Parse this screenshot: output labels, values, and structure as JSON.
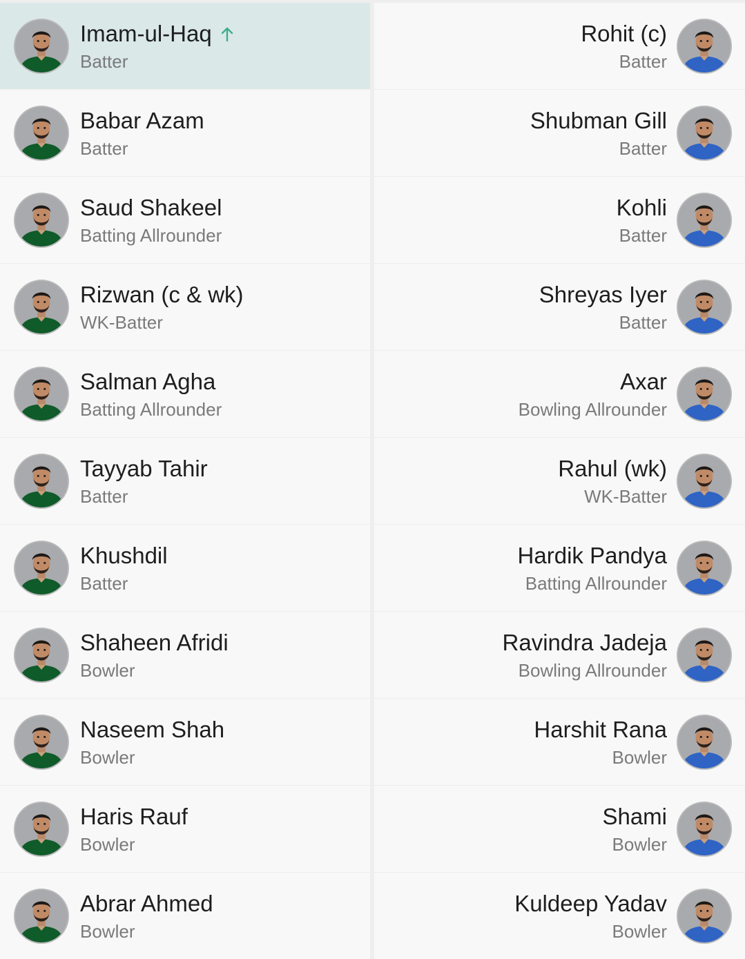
{
  "colors": {
    "row_bg": "#f8f8f8",
    "highlight_bg": "#dae8e8",
    "substitute_arrow": "#3fae8a",
    "pakistan_jersey": "#0f5b2a",
    "india_jersey": "#2f63c4"
  },
  "teams": [
    {
      "side": "left",
      "players": [
        {
          "name": "Imam-ul-Haq",
          "role": "Batter",
          "highlight": true,
          "icon": "arrow-up-icon"
        },
        {
          "name": "Babar Azam",
          "role": "Batter"
        },
        {
          "name": "Saud Shakeel",
          "role": "Batting Allrounder"
        },
        {
          "name": "Rizwan (c & wk)",
          "role": "WK-Batter"
        },
        {
          "name": "Salman Agha",
          "role": "Batting Allrounder"
        },
        {
          "name": "Tayyab Tahir",
          "role": "Batter"
        },
        {
          "name": "Khushdil",
          "role": "Batter"
        },
        {
          "name": "Shaheen Afridi",
          "role": "Bowler"
        },
        {
          "name": "Naseem Shah",
          "role": "Bowler"
        },
        {
          "name": "Haris Rauf",
          "role": "Bowler"
        },
        {
          "name": "Abrar Ahmed",
          "role": "Bowler"
        }
      ]
    },
    {
      "side": "right",
      "players": [
        {
          "name": "Rohit (c)",
          "role": "Batter"
        },
        {
          "name": "Shubman Gill",
          "role": "Batter"
        },
        {
          "name": "Kohli",
          "role": "Batter"
        },
        {
          "name": "Shreyas Iyer",
          "role": "Batter"
        },
        {
          "name": "Axar",
          "role": "Bowling Allrounder"
        },
        {
          "name": "Rahul (wk)",
          "role": "WK-Batter"
        },
        {
          "name": "Hardik Pandya",
          "role": "Batting Allrounder"
        },
        {
          "name": "Ravindra Jadeja",
          "role": "Bowling Allrounder"
        },
        {
          "name": "Harshit Rana",
          "role": "Bowler"
        },
        {
          "name": "Shami",
          "role": "Bowler"
        },
        {
          "name": "Kuldeep Yadav",
          "role": "Bowler"
        }
      ]
    }
  ]
}
